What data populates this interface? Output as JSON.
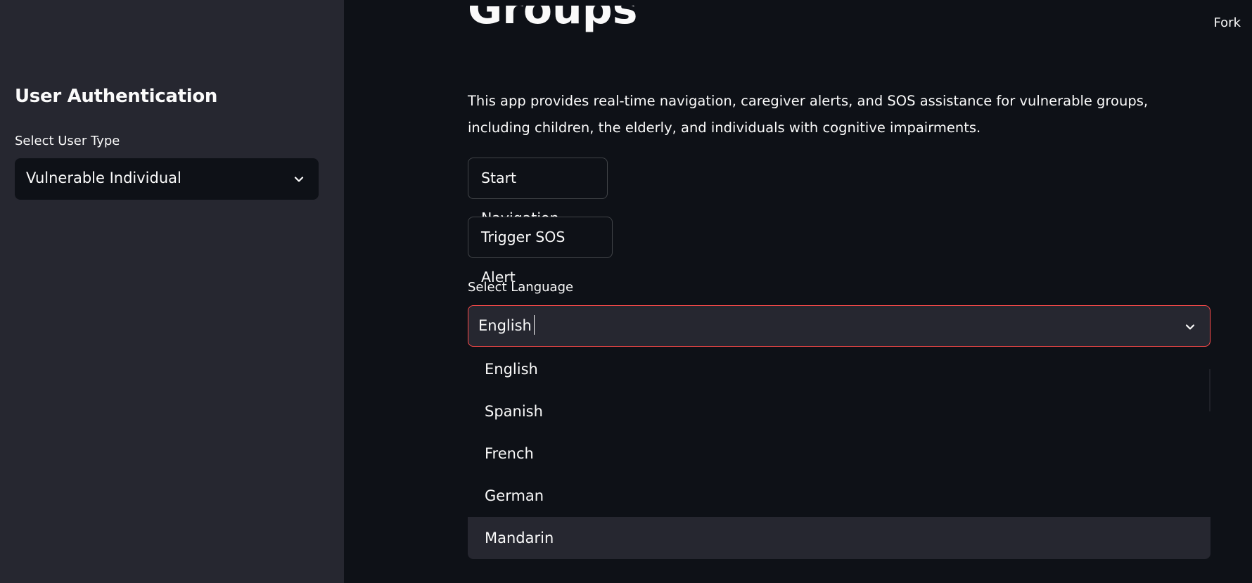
{
  "sidebar": {
    "heading": "User Authentication",
    "user_type_label": "Select User Type",
    "user_type_value": "Vulnerable Individual",
    "chevron_icon": "chevron-down-icon"
  },
  "header": {
    "fork_label": "Fork"
  },
  "main": {
    "title": "Groups",
    "description": "This app provides real-time navigation, caregiver alerts, and SOS assistance for vulnerable groups, including children, the elderly, and individuals with cognitive impairments.",
    "buttons": {
      "start_navigation": "Start Navigation",
      "trigger_sos": "Trigger SOS Alert"
    },
    "language": {
      "label": "Select Language",
      "value": "English",
      "options": [
        "English",
        "Spanish",
        "French",
        "German",
        "Mandarin"
      ],
      "highlighted_option": "Mandarin"
    }
  },
  "colors": {
    "background": "#0e1117",
    "sidebar": "#262730",
    "focus_border": "#ff4b4b",
    "text": "#fafafa"
  }
}
